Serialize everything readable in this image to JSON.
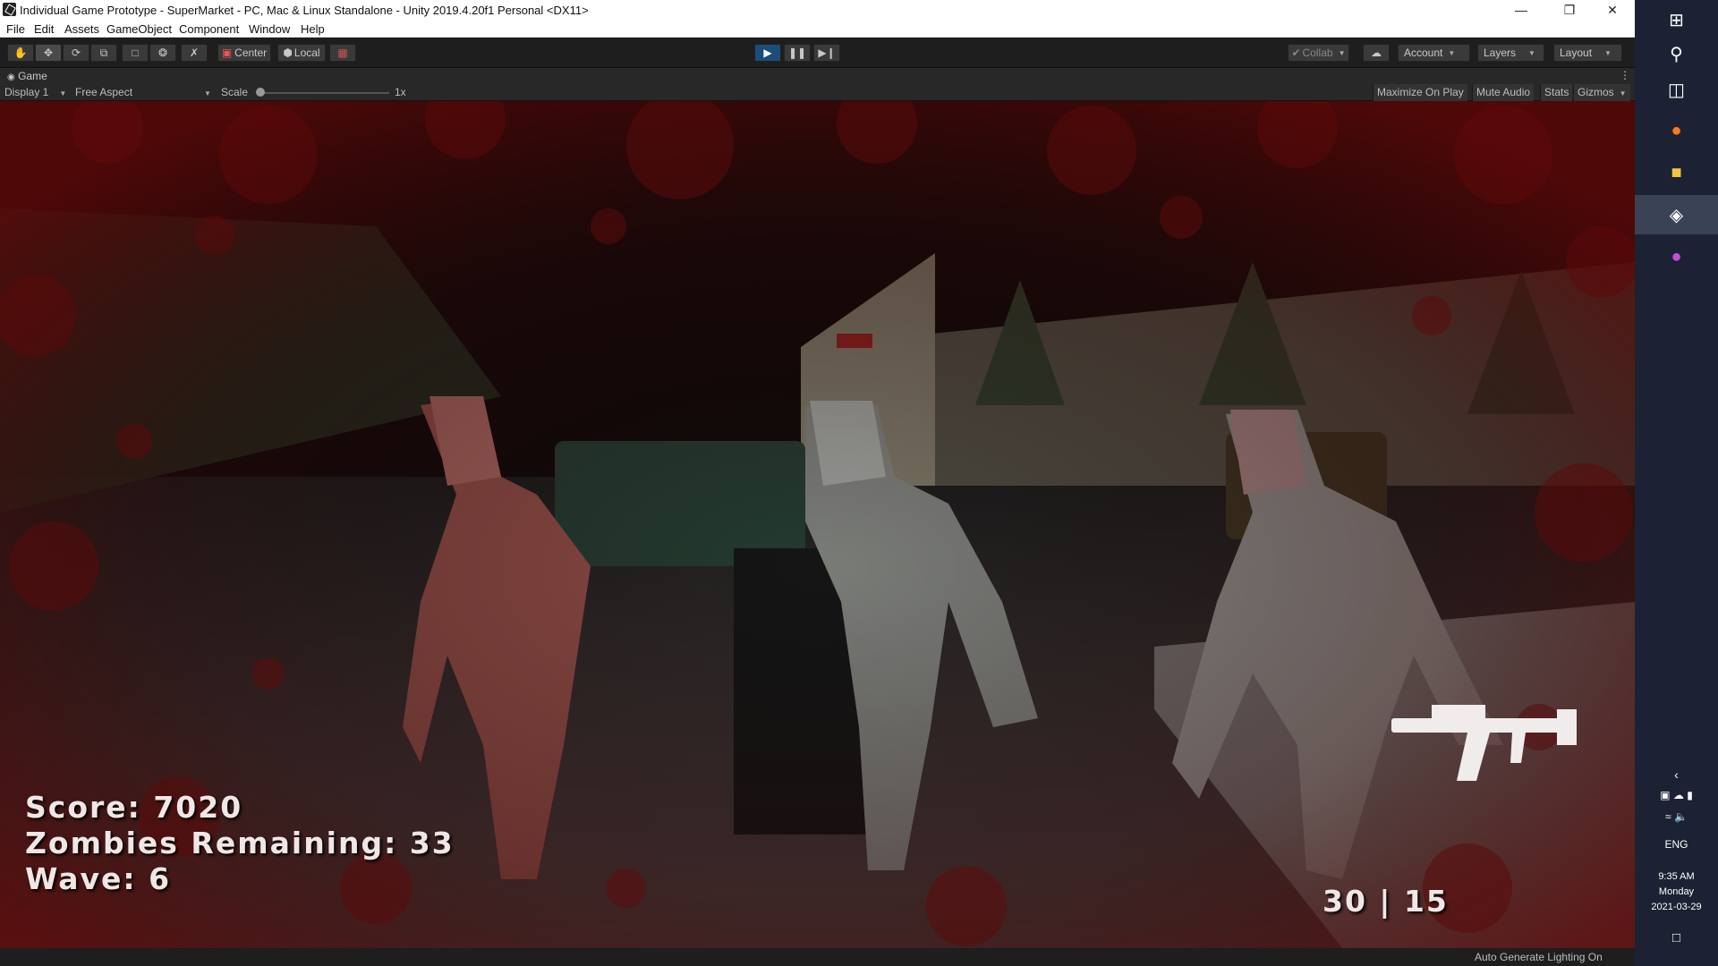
{
  "window": {
    "title": "Individual Game Prototype - SuperMarket - PC, Mac & Linux Standalone - Unity 2019.4.20f1 Personal <DX11>",
    "min_icon": "minimize-icon",
    "max_icon": "restore-icon",
    "close_icon": "close-icon"
  },
  "menu": [
    "File",
    "Edit",
    "Assets",
    "GameObject",
    "Component",
    "Window",
    "Help"
  ],
  "toolbar": {
    "tools": [
      "hand-icon",
      "move-icon",
      "rotate-icon",
      "scale-icon",
      "rect-icon",
      "transform-icon",
      "custom-tool-icon"
    ],
    "pivot": "Center",
    "space": "Local",
    "collab": "Collab",
    "account": "Account",
    "layers": "Layers",
    "layout": "Layout"
  },
  "game_view": {
    "tab": "Game",
    "display": "Display 1",
    "aspect": "Free Aspect",
    "scale_label": "Scale",
    "scale_value": "1x",
    "maximize": "Maximize On Play",
    "mute": "Mute Audio",
    "stats": "Stats",
    "gizmos": "Gizmos"
  },
  "hud": {
    "score": "Score:  7020",
    "zombies": "Zombies  Remaining:  33",
    "wave": "Wave:  6",
    "ammo": "30  |  15"
  },
  "status": "Auto Generate Lighting On",
  "taskbar": {
    "language": "ENG",
    "time": "9:35 AM",
    "day": "Monday",
    "date": "2021-03-29"
  },
  "colors": {
    "play_active": "#1c4d7a",
    "taskbar": "#1c2233",
    "blood": "#7a0f0f"
  }
}
